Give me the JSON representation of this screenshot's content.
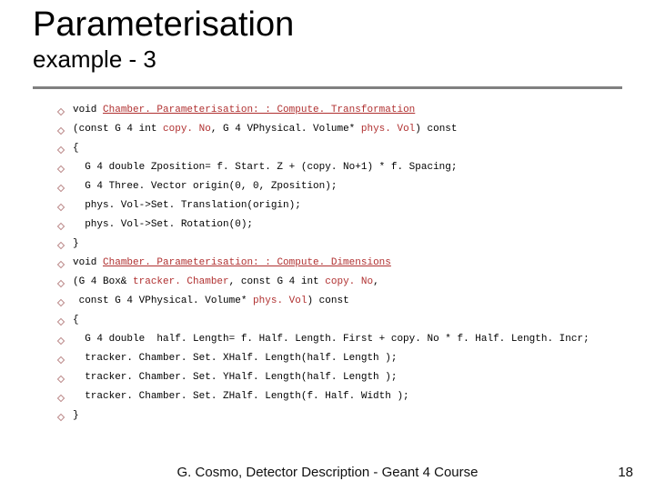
{
  "title": "Parameterisation",
  "subtitle": "example - 3",
  "lines": [
    {
      "pre": "void ",
      "kw": "Chamber. Parameterisation: : Compute. Transformation",
      "post": ""
    },
    {
      "pre": "(const G 4 int ",
      "var": "copy. No",
      "mid": ", G 4 VPhysical. Volume* ",
      "var2": "phys. Vol",
      "post": ") const"
    },
    {
      "text": "{"
    },
    {
      "text": "  G 4 double Zposition= f. Start. Z + (copy. No+1) * f. Spacing;"
    },
    {
      "text": "  G 4 Three. Vector origin(0, 0, Zposition);"
    },
    {
      "text": "  phys. Vol->Set. Translation(origin);"
    },
    {
      "text": "  phys. Vol->Set. Rotation(0);"
    },
    {
      "text": "}"
    },
    {
      "pre": "void ",
      "kw": "Chamber. Parameterisation: : Compute. Dimensions",
      "post": ""
    },
    {
      "pre": "(G 4 Box& ",
      "var": "tracker. Chamber",
      "mid": ", const G 4 int ",
      "var2": "copy. No",
      "post": ","
    },
    {
      "pre": " const G 4 VPhysical. Volume* ",
      "var": "phys. Vol",
      "post": ") const"
    },
    {
      "text": "{"
    },
    {
      "text": "  G 4 double  half. Length= f. Half. Length. First + copy. No * f. Half. Length. Incr;"
    },
    {
      "text": "  tracker. Chamber. Set. XHalf. Length(half. Length );"
    },
    {
      "text": "  tracker. Chamber. Set. YHalf. Length(half. Length );"
    },
    {
      "text": "  tracker. Chamber. Set. ZHalf. Length(f. Half. Width );"
    },
    {
      "text": "}"
    }
  ],
  "footer": "G. Cosmo, Detector Description - Geant 4 Course",
  "page": "18"
}
